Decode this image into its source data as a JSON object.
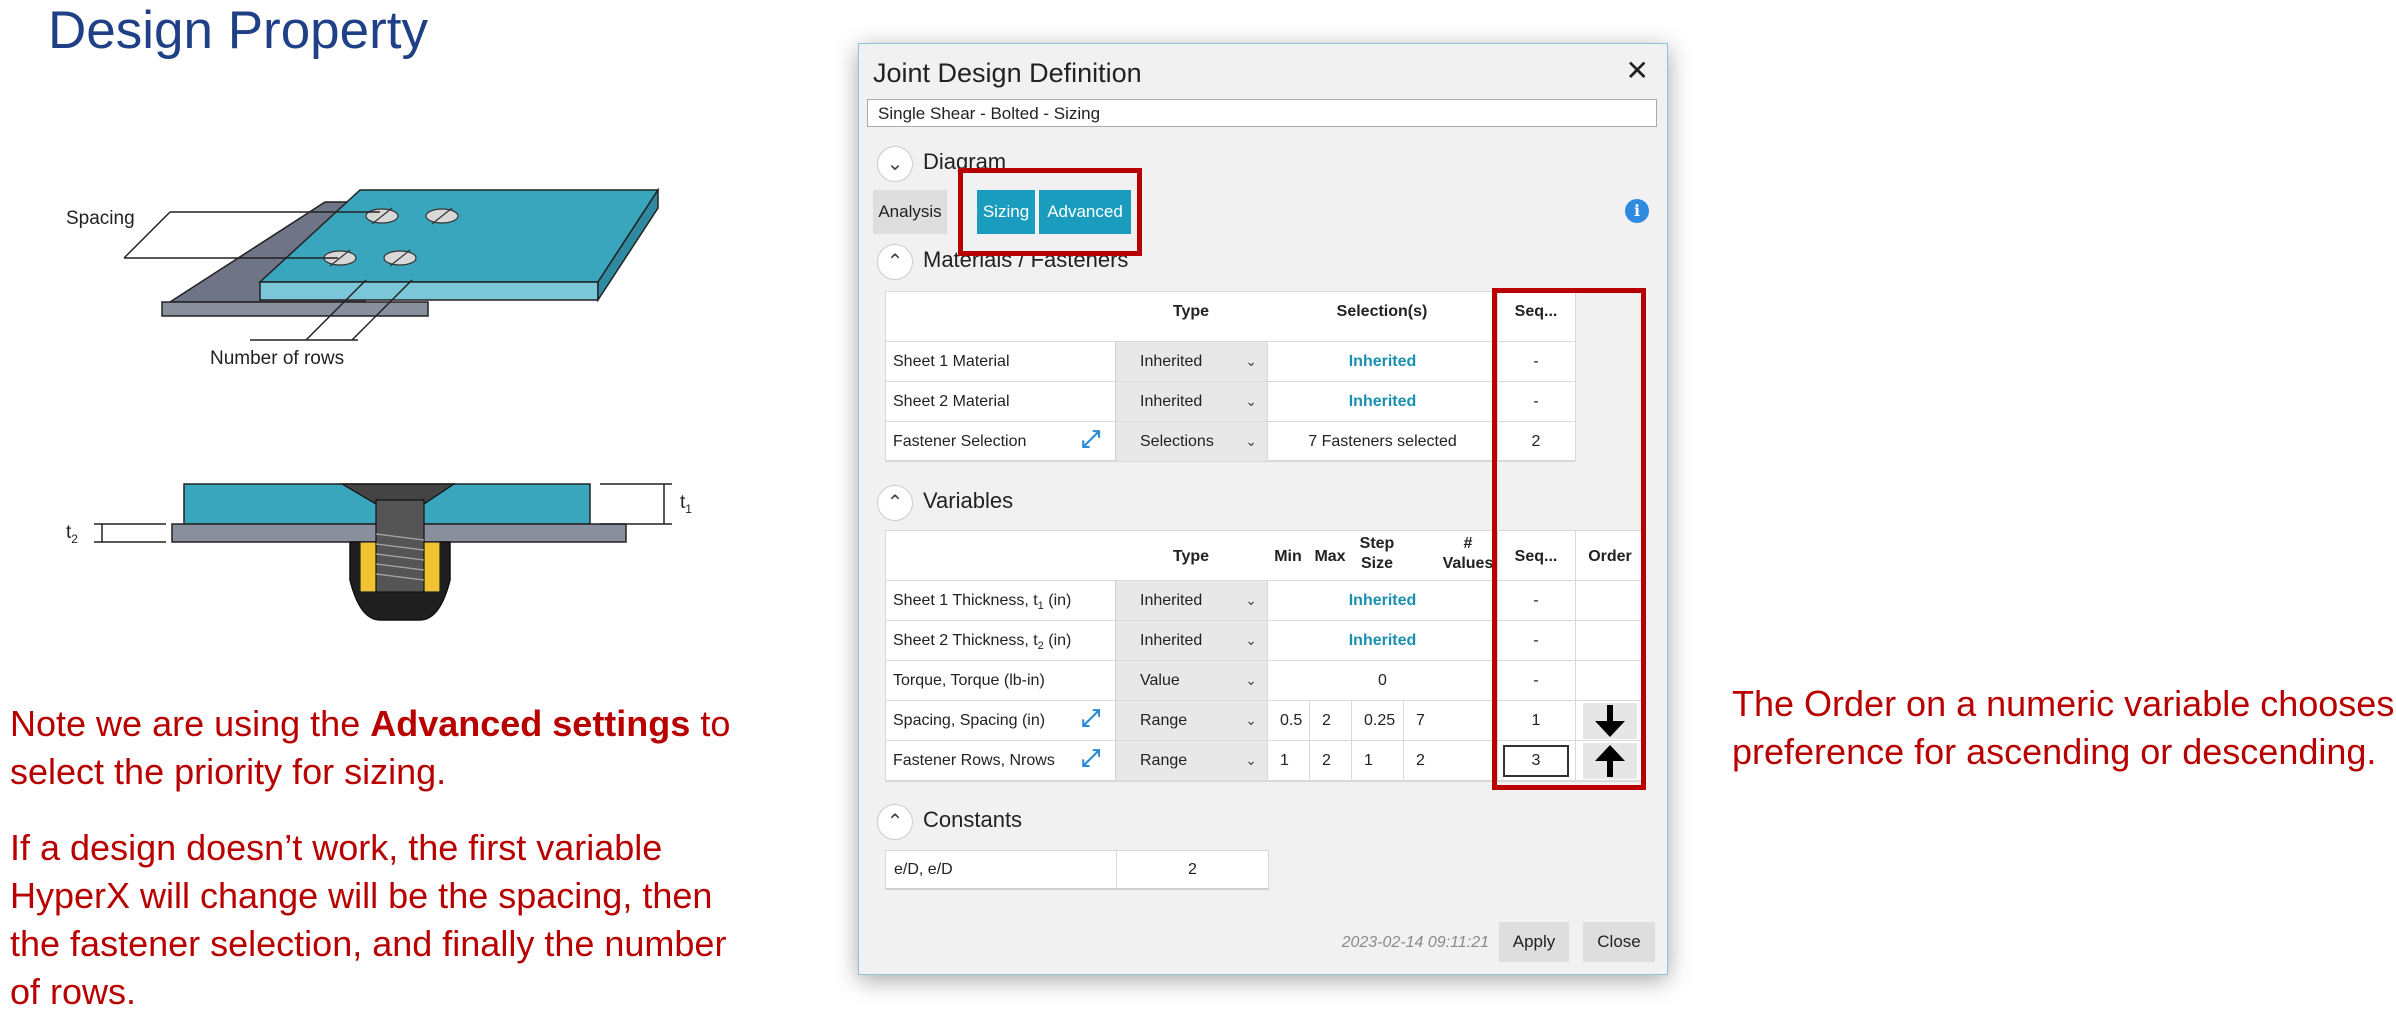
{
  "slide": {
    "title": "Design Property",
    "labels": {
      "spacing": "Spacing",
      "rows": "Number of rows",
      "t1": "t",
      "t1_sub": "1",
      "t2": "t",
      "t2_sub": "2"
    },
    "note1_pre": "Note we are using the ",
    "note1_bold": "Advanced settings",
    "note1_post": " to select the priority for sizing.",
    "note2": "If a design doesn’t work, the first variable HyperX will change will be the spacing, then the fastener selection, and finally the number of rows.",
    "right_note": "The Order on a numeric variable chooses preference for ascending or descending."
  },
  "dialog": {
    "title": "Joint Design Definition",
    "close_glyph": "✕",
    "subtitle": "Single Shear - Bolted - Sizing",
    "diagram_section": "Diagram",
    "tabs": {
      "analysis": "Analysis",
      "sizing": "Sizing",
      "advanced": "Advanced"
    },
    "info_glyph": "i",
    "materials_section": "Materials / Fasteners",
    "materials_headers": {
      "type": "Type",
      "selections": "Selection(s)",
      "seq": "Seq..."
    },
    "materials_rows": [
      {
        "label": "Sheet 1 Material",
        "type": "Inherited",
        "selection": "Inherited",
        "seq": "-"
      },
      {
        "label": "Sheet 2 Material",
        "type": "Inherited",
        "selection": "Inherited",
        "seq": "-"
      },
      {
        "label": "Fastener Selection",
        "type": "Selections",
        "selection": "7 Fasteners selected",
        "seq": "2"
      }
    ],
    "variables_section": "Variables",
    "variables_headers": {
      "type": "Type",
      "min": "Min",
      "max": "Max",
      "step1": "Step",
      "step2": "Size",
      "nval1": "#",
      "nval2": "Values",
      "seq": "Seq...",
      "order": "Order"
    },
    "variables_rows": [
      {
        "label": "Sheet 1 Thickness, t",
        "sub": "1",
        "unit": " (in)",
        "type": "Inherited",
        "value": "Inherited",
        "seq": "-"
      },
      {
        "label": "Sheet 2 Thickness, t",
        "sub": "2",
        "unit": " (in)",
        "type": "Inherited",
        "value": "Inherited",
        "seq": "-"
      },
      {
        "label": "Torque, Torque (lb-in)",
        "type": "Value",
        "value": "0",
        "seq": "-"
      },
      {
        "label": "Spacing, Spacing (in)",
        "type": "Range",
        "min": "0.5",
        "max": "2",
        "step": "0.25",
        "nvalues": "7",
        "seq": "1",
        "order": "descending"
      },
      {
        "label": "Fastener Rows, Nrows",
        "type": "Range",
        "min": "1",
        "max": "2",
        "step": "1",
        "nvalues": "2",
        "seq": "3",
        "order": "ascending"
      }
    ],
    "constants_section": "Constants",
    "constants_rows": [
      {
        "label": "e/D, e/D",
        "value": "2"
      }
    ],
    "timestamp": "2023-02-14 09:11:21",
    "apply": "Apply",
    "close": "Close"
  },
  "colors": {
    "accent": "#1a9cbf",
    "highlight": "#b80000",
    "title": "#1f3f86",
    "inherited": "#1a8fb0"
  },
  "icons": {
    "expand": "expand-arrow-icon",
    "chevron_up": "chevron-up-icon",
    "chevron_down": "chevron-down-icon",
    "dropdown": "dropdown-arrow-icon",
    "order_down": "arrow-down-icon",
    "order_up": "arrow-up-icon",
    "info": "info-icon"
  }
}
